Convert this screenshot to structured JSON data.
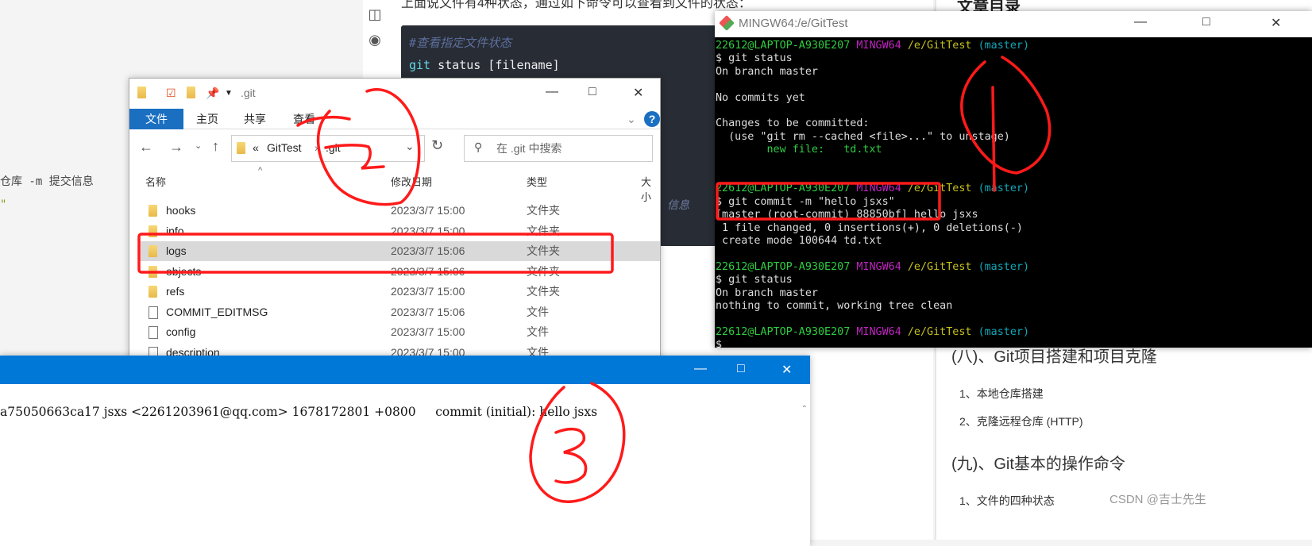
{
  "article": {
    "top_text": "上面说文件有4种状态，通过如下命令可以查看到文件的状态：",
    "code_comment": "#查看指定文件状态",
    "code_cmd": "git",
    "code_args": "status",
    "code_bracket": "[filename]",
    "left_text": "仓库 -m 提交信息",
    "left_quote": "\"",
    "behind_text": "信息",
    "icons": [
      "columns-icon",
      "eye-icon"
    ]
  },
  "sidebar": {
    "title": "文章目录",
    "items": [
      {
        "label": "(八)、Git项目搭建和项目克隆",
        "level": "h"
      },
      {
        "label": "1、本地仓库搭建",
        "level": "s"
      },
      {
        "label": "2、克隆远程仓库 (HTTP)",
        "level": "s"
      },
      {
        "label": "(九)、Git基本的操作命令",
        "level": "h"
      },
      {
        "label": "1、文件的四种状态",
        "level": "s"
      }
    ],
    "watermark": "CSDN @吉士先生"
  },
  "explorer": {
    "title": ".git",
    "tabs": [
      "文件",
      "主页",
      "共享",
      "查看"
    ],
    "breadcrumb": [
      "«",
      "GitTest",
      "›",
      ".git"
    ],
    "search_placeholder": "在 .git 中搜索",
    "columns": [
      "名称",
      "修改日期",
      "类型",
      "大小"
    ],
    "rows": [
      {
        "name": "hooks",
        "date": "2023/3/7 15:00",
        "type": "文件夹",
        "kind": "folder"
      },
      {
        "name": "info",
        "date": "2023/3/7 15:00",
        "type": "文件夹",
        "kind": "folder"
      },
      {
        "name": "logs",
        "date": "2023/3/7 15:06",
        "type": "文件夹",
        "kind": "folder",
        "selected": true
      },
      {
        "name": "objects",
        "date": "2023/3/7 15:06",
        "type": "文件夹",
        "kind": "folder"
      },
      {
        "name": "refs",
        "date": "2023/3/7 15:00",
        "type": "文件夹",
        "kind": "folder"
      },
      {
        "name": "COMMIT_EDITMSG",
        "date": "2023/3/7 15:06",
        "type": "文件",
        "kind": "file"
      },
      {
        "name": "config",
        "date": "2023/3/7 15:00",
        "type": "文件",
        "kind": "file"
      },
      {
        "name": "description",
        "date": "2023/3/7 15:00",
        "type": "文件",
        "kind": "file"
      }
    ]
  },
  "terminal": {
    "title": "MINGW64:/e/GitTest",
    "prompt": {
      "user": "22612@LAPTOP-A930E207",
      "sys": "MINGW64",
      "path": "/e/GitTest",
      "branch": "(master)"
    },
    "lines": {
      "cmd1": "$ git status",
      "l1": "On branch master",
      "l2": "No commits yet",
      "l3": "Changes to be committed:",
      "l4": "  (use \"git rm --cached <file>...\" to unstage)",
      "l5": "        new file:   td.txt",
      "cmd2": "$ git commit -m \"hello jsxs\"",
      "l6": "[master (root-commit) 88850bf] hello jsxs",
      "l7": " 1 file changed, 0 insertions(+), 0 deletions(-)",
      "l8": " create mode 100644 td.txt",
      "cmd3": "$ git status",
      "l9": "On branch master",
      "l10": "nothing to commit, working tree clean",
      "cmd4": "$ "
    }
  },
  "notepad": {
    "content": "a75050663ca17 jsxs <2261203961@qq.com> 1678172801 +0800     commit (initial): hello jsxs"
  },
  "annotations": {
    "colors": {
      "red": "#ff1a1a"
    },
    "labels": [
      "1",
      "2",
      "3"
    ]
  },
  "colors": {
    "title_blue": "#0078d7",
    "ribbon_blue": "#1a6fc1",
    "code_bg": "#282c34"
  }
}
